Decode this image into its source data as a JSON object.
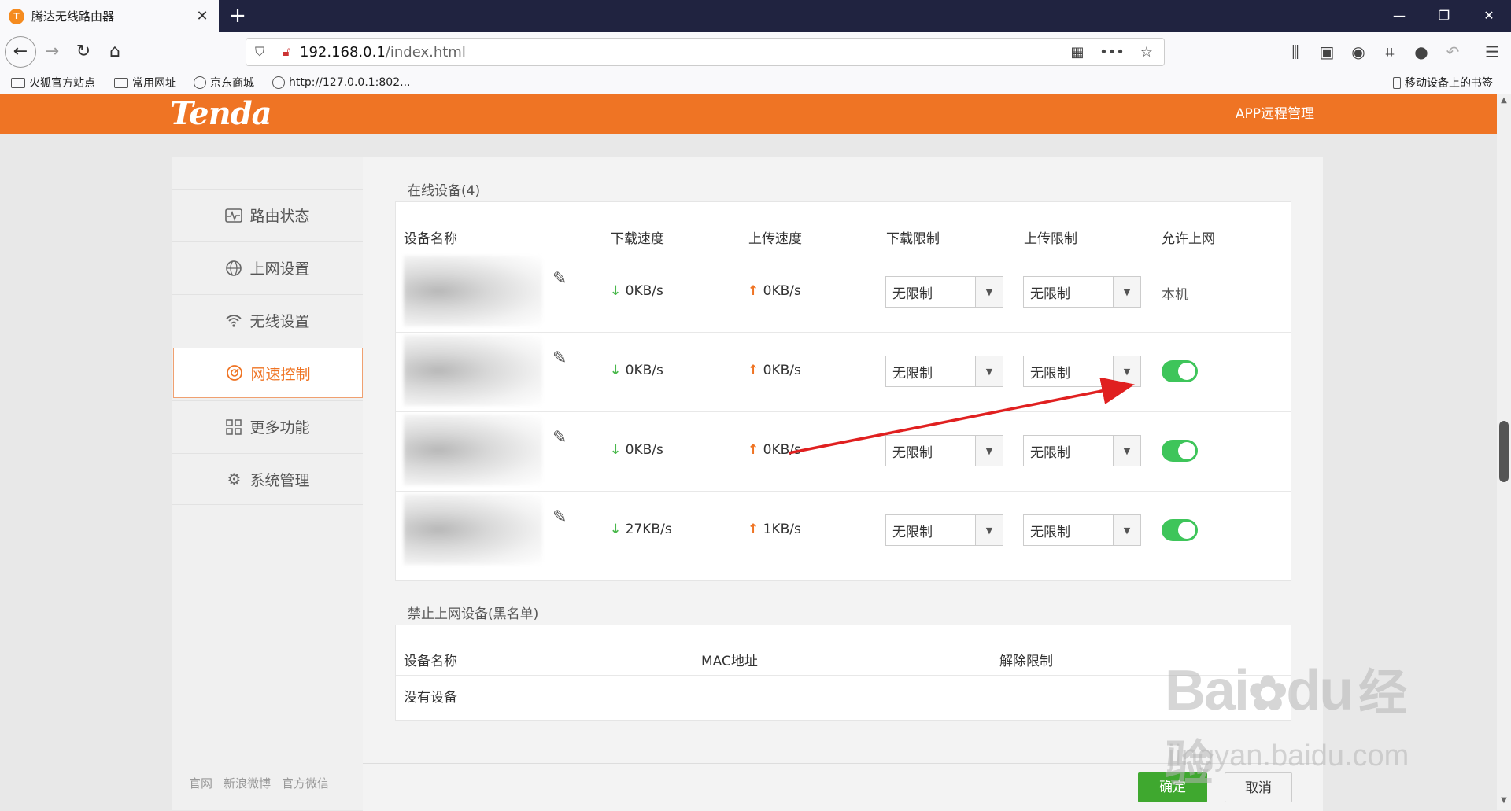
{
  "browser": {
    "tab_title": "腾达无线路由器",
    "favicon_text": "T",
    "url_main": "192.168.0.1",
    "url_path": "/index.html",
    "bookmarks": [
      {
        "label": "火狐官方站点"
      },
      {
        "label": "常用网址"
      },
      {
        "label": "京东商城"
      },
      {
        "label": "http://127.0.0.1:802..."
      }
    ],
    "mobile_bookmarks": "移动设备上的书签"
  },
  "header": {
    "logo": "Tenda",
    "app_remote": "APP远程管理"
  },
  "sidebar": {
    "items": [
      {
        "label": "路由状态"
      },
      {
        "label": "上网设置"
      },
      {
        "label": "无线设置"
      },
      {
        "label": "网速控制"
      },
      {
        "label": "更多功能"
      },
      {
        "label": "系统管理"
      }
    ],
    "footer": [
      "官网",
      "新浪微博",
      "官方微信"
    ]
  },
  "online": {
    "title": "在线设备(4)",
    "columns": [
      "设备名称",
      "下载速度",
      "上传速度",
      "下载限制",
      "上传限制",
      "允许上网"
    ],
    "rows": [
      {
        "down": "0KB/s",
        "up": "0KB/s",
        "down_limit": "无限制",
        "up_limit": "无限制",
        "allow": "本机",
        "allow_on": false
      },
      {
        "down": "0KB/s",
        "up": "0KB/s",
        "down_limit": "无限制",
        "up_limit": "无限制",
        "allow": "",
        "allow_on": true
      },
      {
        "down": "0KB/s",
        "up": "0KB/s",
        "down_limit": "无限制",
        "up_limit": "无限制",
        "allow": "",
        "allow_on": true
      },
      {
        "down": "27KB/s",
        "up": "1KB/s",
        "down_limit": "无限制",
        "up_limit": "无限制",
        "allow": "",
        "allow_on": true
      }
    ],
    "arrow_down": "↓",
    "arrow_up": "↑"
  },
  "blacklist": {
    "title": "禁止上网设备(黑名单)",
    "columns": [
      "设备名称",
      "MAC地址",
      "解除限制"
    ],
    "empty": "没有设备"
  },
  "buttons": {
    "ok": "确定",
    "cancel": "取消"
  },
  "watermark": {
    "brand": "Bai",
    "brand2": "du",
    "cn": "经验",
    "site": "jingyan.baidu.com"
  },
  "colors": {
    "accent": "#ef7424",
    "toggle_on": "#3ec55a",
    "ok_button": "#3fa82f",
    "annotation_arrow": "#e02020"
  }
}
